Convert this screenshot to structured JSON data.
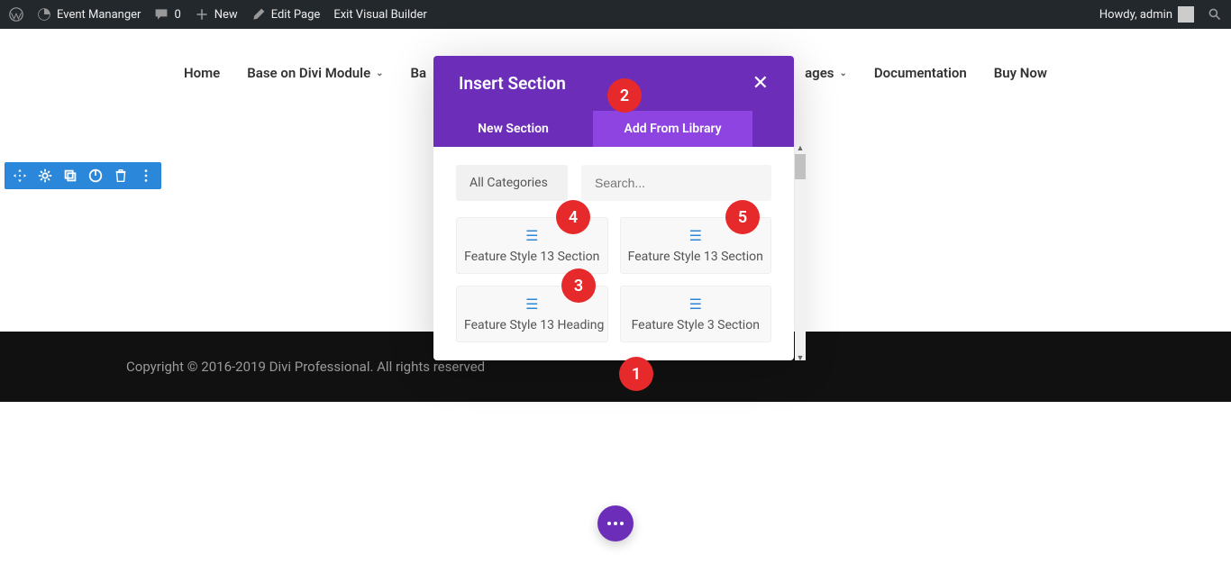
{
  "admin_bar": {
    "site_name": "Event Mananger",
    "comments_count": "0",
    "new_label": "New",
    "edit_page": "Edit Page",
    "exit_vb": "Exit Visual Builder",
    "howdy": "Howdy, admin"
  },
  "nav": {
    "home": "Home",
    "divi_module": "Base on Divi Module",
    "ba": "Ba",
    "ages": "ages",
    "documentation": "Documentation",
    "buy_now": "Buy Now"
  },
  "modal": {
    "title": "Insert Section",
    "tab_new": "New Section",
    "tab_library": "Add From Library",
    "categories": "All Categories",
    "search_placeholder": "Search...",
    "cards": [
      "Feature Style 13 Section",
      "Feature Style 13 Section",
      "Feature Style 13 Heading",
      "Feature Style 3 Section"
    ]
  },
  "footer": {
    "copyright": "Copyright © 2016-2019 Divi Professional. All rights reserved"
  },
  "annotations": {
    "1": "1",
    "2": "2",
    "3": "3",
    "4": "4",
    "5": "5"
  },
  "icons": {
    "close": "✕",
    "plus": "+",
    "hamburger": "☰",
    "chevron": "⌄"
  }
}
